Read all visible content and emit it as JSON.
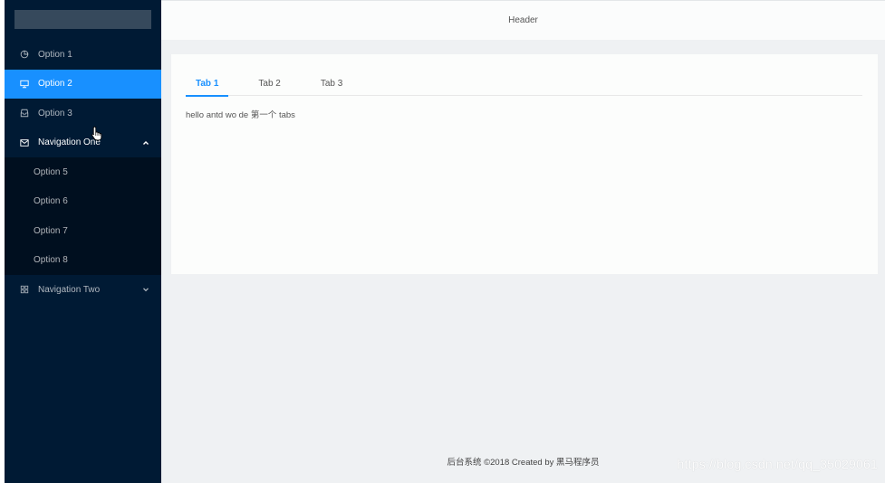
{
  "header": {
    "title": "Header"
  },
  "sidebar": {
    "items": [
      {
        "label": "Option 1",
        "icon": "pie-chart-icon"
      },
      {
        "label": "Option 2",
        "icon": "desktop-icon",
        "selected": true
      },
      {
        "label": "Option 3",
        "icon": "inbox-icon"
      }
    ],
    "navigation_one": {
      "label": "Navigation One",
      "icon": "mail-icon",
      "expanded": true,
      "children": [
        "Option 5",
        "Option 6",
        "Option 7",
        "Option 8"
      ]
    },
    "navigation_two": {
      "label": "Navigation Two",
      "icon": "appstore-icon",
      "expanded": false
    }
  },
  "tabs": {
    "items": [
      "Tab 1",
      "Tab 2",
      "Tab 3"
    ],
    "active": "Tab 1",
    "content": "hello antd wo de 第一个 tabs"
  },
  "footer": {
    "text": "后台系统 ©2018 Created by 黑马程序员"
  },
  "watermark": {
    "text": "https://blog.csdn.net/qq_35029061"
  },
  "colors": {
    "sider_bg": "#001a34",
    "submenu_bg": "#000f1f",
    "accent": "#1890ff",
    "content_bg": "#eff1f3"
  }
}
